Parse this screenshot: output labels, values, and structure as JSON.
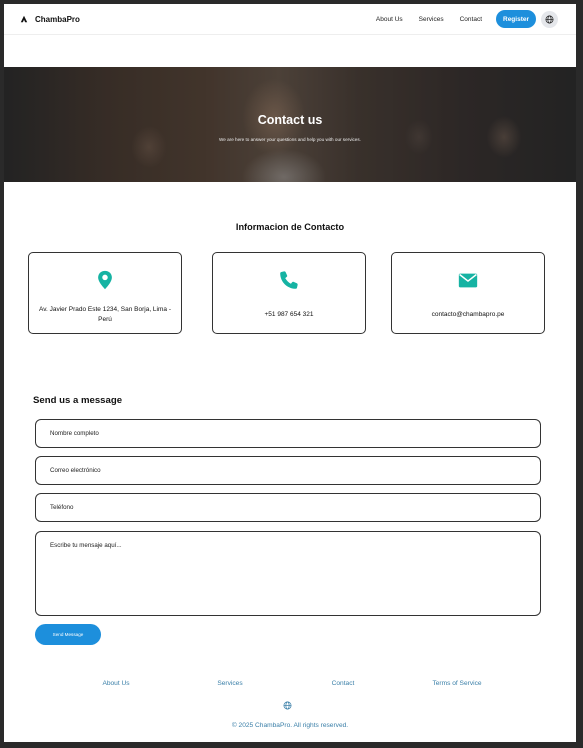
{
  "header": {
    "brand": "ChambaPro",
    "nav": [
      "About Us",
      "Services",
      "Contact"
    ],
    "register_label": "Register"
  },
  "hero": {
    "title": "Contact us",
    "subtitle": "We are here to answer your questions and help you with our services."
  },
  "contact_info": {
    "title": "Informacion de Contacto",
    "address": "Av. Javier Prado Este 1234, San Borja, Lima - Perú",
    "phone": "+51 987 654 321",
    "email": "contacto@chambapro.pe",
    "icon_color": "#16b3a3"
  },
  "form": {
    "title": "Send us a message",
    "name_placeholder": "Nombre completo",
    "email_placeholder": "Correo electrónico",
    "phone_placeholder": "Teléfono",
    "message_placeholder": "Escribe tu mensaje aquí...",
    "send_label": "Send Message"
  },
  "footer": {
    "links": [
      "About Us",
      "Services",
      "Contact",
      "Terms of Service"
    ],
    "copyright": "© 2025 ChambaPro. All rights reserved."
  },
  "colors": {
    "accent": "#1d8fdc",
    "footer_link": "#3a7fa8"
  }
}
